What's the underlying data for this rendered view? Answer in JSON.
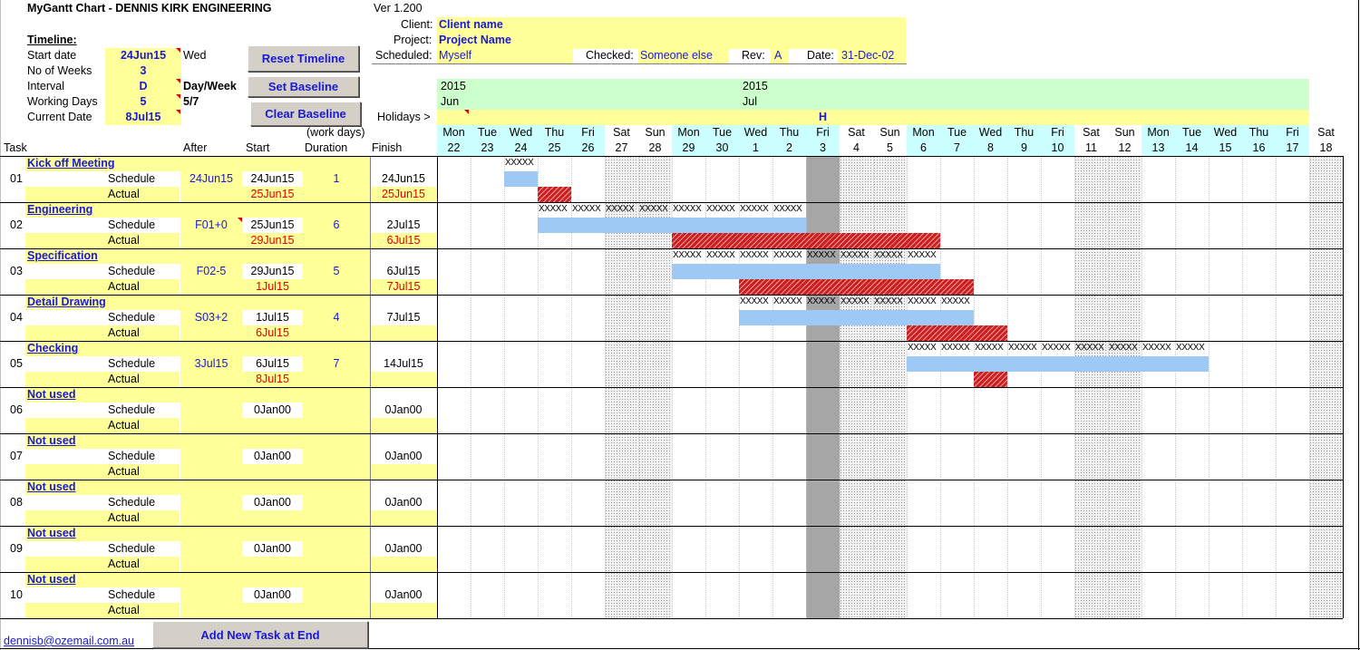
{
  "header": {
    "title": "MyGantt Chart - DENNIS KIRK ENGINEERING",
    "version": "Ver 1.200"
  },
  "project": {
    "client_label": "Client:",
    "client": "Client name",
    "project_label": "Project:",
    "project": "Project Name",
    "scheduled_label": "Scheduled:",
    "scheduled": "Myself",
    "checked_label": "Checked:",
    "checked": "Someone else",
    "rev_label": "Rev:",
    "rev": "A",
    "date_label": "Date:",
    "date": "31-Dec-02"
  },
  "timeline": {
    "heading": "Timeline:",
    "start_label": "Start date",
    "start": "24Jun15",
    "start_day": "Wed",
    "weeks_label": "No of Weeks",
    "weeks": "3",
    "interval_label": "Interval",
    "interval": "D",
    "interval_unit": "Day/Week",
    "working_label": "Working Days",
    "working": "5",
    "working_ratio": "5/7",
    "current_label": "Current Date",
    "current": "8Jul15"
  },
  "buttons": {
    "reset": "Reset Timeline",
    "set_baseline": "Set Baseline",
    "clear_baseline": "Clear Baseline",
    "add_task": "Add New Task at End"
  },
  "holidays_label": "Holidays >",
  "holiday_mark": "H",
  "columns": {
    "task": "Task",
    "after": "After",
    "start": "Start",
    "duration_note": "(work days)",
    "duration": "Duration",
    "finish": "Finish"
  },
  "row_labels": {
    "schedule": "Schedule",
    "actual": "Actual"
  },
  "months": [
    {
      "year": "2015",
      "month": "Jun"
    },
    {
      "year": "2015",
      "month": "Jul"
    }
  ],
  "days": [
    {
      "dow": "Mon",
      "dom": "22"
    },
    {
      "dow": "Tue",
      "dom": "23"
    },
    {
      "dow": "Wed",
      "dom": "24"
    },
    {
      "dow": "Thu",
      "dom": "25"
    },
    {
      "dow": "Fri",
      "dom": "26"
    },
    {
      "dow": "Sat",
      "dom": "27"
    },
    {
      "dow": "Sun",
      "dom": "28"
    },
    {
      "dow": "Mon",
      "dom": "29"
    },
    {
      "dow": "Tue",
      "dom": "30"
    },
    {
      "dow": "Wed",
      "dom": "1"
    },
    {
      "dow": "Thu",
      "dom": "2"
    },
    {
      "dow": "Fri",
      "dom": "3"
    },
    {
      "dow": "Sat",
      "dom": "4"
    },
    {
      "dow": "Sun",
      "dom": "5"
    },
    {
      "dow": "Mon",
      "dom": "6"
    },
    {
      "dow": "Tue",
      "dom": "7"
    },
    {
      "dow": "Wed",
      "dom": "8"
    },
    {
      "dow": "Thu",
      "dom": "9"
    },
    {
      "dow": "Fri",
      "dom": "10"
    },
    {
      "dow": "Sat",
      "dom": "11"
    },
    {
      "dow": "Sun",
      "dom": "12"
    },
    {
      "dow": "Mon",
      "dom": "13"
    },
    {
      "dow": "Tue",
      "dom": "14"
    },
    {
      "dow": "Wed",
      "dom": "15"
    },
    {
      "dow": "Thu",
      "dom": "16"
    },
    {
      "dow": "Fri",
      "dom": "17"
    },
    {
      "dow": "Sat",
      "dom": "18"
    }
  ],
  "baseline_mark": "XXXXX",
  "tasks": [
    {
      "num": "01",
      "name": "Kick off Meeting",
      "after": "24Jun15",
      "start": "24Jun15",
      "duration": "1",
      "finish": "24Jun15",
      "actual_start": "25Jun15",
      "actual_finish": "25Jun15"
    },
    {
      "num": "02",
      "name": "Engineering",
      "after": "F01+0",
      "start": "25Jun15",
      "duration": "6",
      "finish": "2Jul15",
      "actual_start": "29Jun15",
      "actual_finish": "6Jul15"
    },
    {
      "num": "03",
      "name": "Specification",
      "after": "F02-5",
      "start": "29Jun15",
      "duration": "5",
      "finish": "6Jul15",
      "actual_start": "1Jul15",
      "actual_finish": "7Jul15"
    },
    {
      "num": "04",
      "name": "Detail Drawing",
      "after": "S03+2",
      "start": "1Jul15",
      "duration": "4",
      "finish": "7Jul15",
      "actual_start": "6Jul15",
      "actual_finish": ""
    },
    {
      "num": "05",
      "name": "Checking",
      "after": "3Jul15",
      "start": "6Jul15",
      "duration": "7",
      "finish": "14Jul15",
      "actual_start": "8Jul15",
      "actual_finish": ""
    },
    {
      "num": "06",
      "name": "Not used",
      "after": "",
      "start": "0Jan00",
      "duration": "",
      "finish": "0Jan00",
      "actual_start": "",
      "actual_finish": ""
    },
    {
      "num": "07",
      "name": "Not used",
      "after": "",
      "start": "0Jan00",
      "duration": "",
      "finish": "0Jan00",
      "actual_start": "",
      "actual_finish": ""
    },
    {
      "num": "08",
      "name": "Not used",
      "after": "",
      "start": "0Jan00",
      "duration": "",
      "finish": "0Jan00",
      "actual_start": "",
      "actual_finish": ""
    },
    {
      "num": "09",
      "name": "Not used",
      "after": "",
      "start": "0Jan00",
      "duration": "",
      "finish": "0Jan00",
      "actual_start": "",
      "actual_finish": ""
    },
    {
      "num": "10",
      "name": "Not used",
      "after": "",
      "start": "0Jan00",
      "duration": "",
      "finish": "0Jan00",
      "actual_start": "",
      "actual_finish": ""
    }
  ],
  "footer": {
    "email": "dennisb@ozemail.com.au"
  }
}
